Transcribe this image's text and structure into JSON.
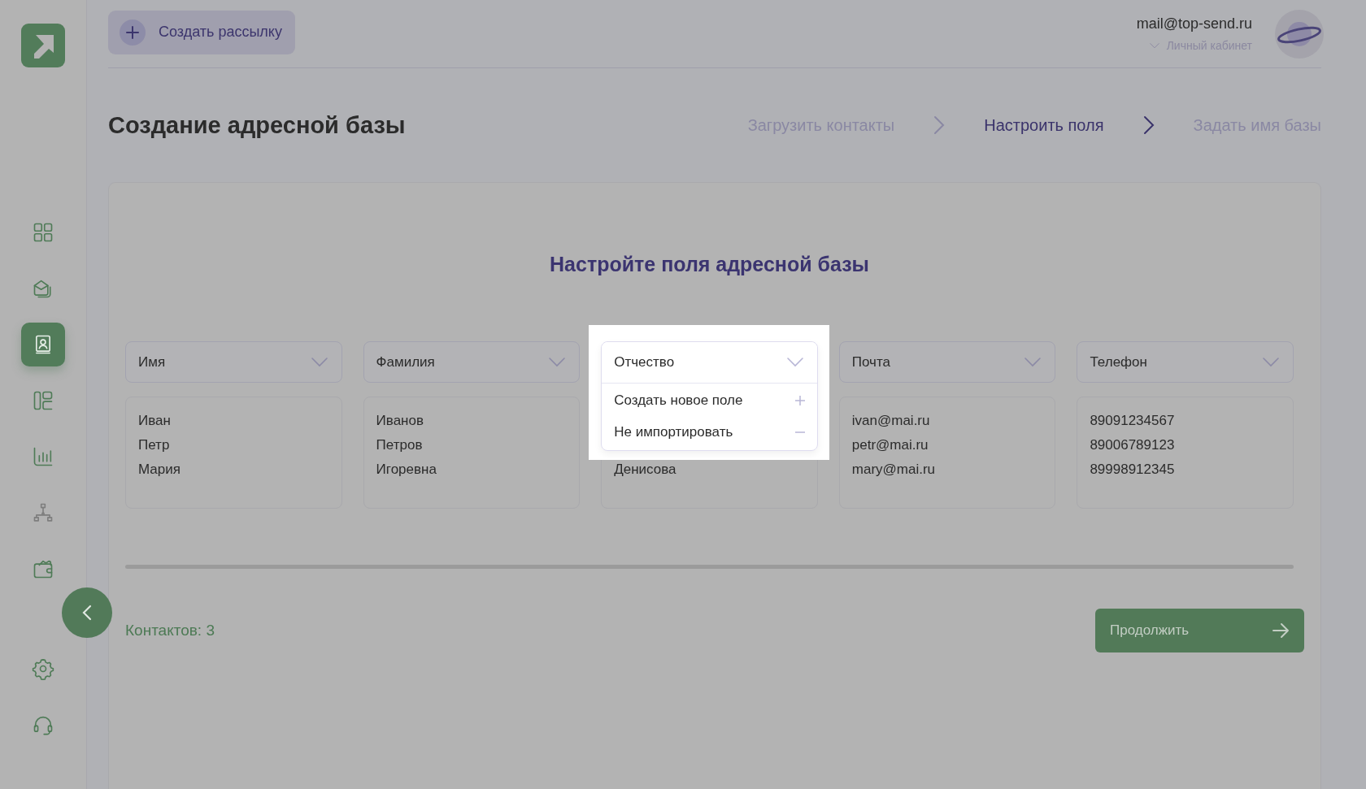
{
  "sidebar": {
    "items": [
      {
        "kind": "dashboard",
        "selected": false,
        "disabled": false
      },
      {
        "kind": "mail",
        "selected": false,
        "disabled": false
      },
      {
        "kind": "contacts",
        "selected": true,
        "disabled": false
      },
      {
        "kind": "templates",
        "selected": false,
        "disabled": false
      },
      {
        "kind": "stats",
        "selected": false,
        "disabled": false
      },
      {
        "kind": "structure",
        "selected": false,
        "disabled": true
      },
      {
        "kind": "wallet",
        "selected": false,
        "disabled": false
      },
      {
        "kind": "settings",
        "selected": false,
        "disabled": false
      },
      {
        "kind": "support",
        "selected": false,
        "disabled": false
      }
    ]
  },
  "header": {
    "create_button": "Создать рассылку",
    "email": "mail@top-send.ru",
    "account_link": "Личный кабинет"
  },
  "page_title": "Создание адресной базы",
  "steps": [
    {
      "label": "Загрузить контакты",
      "selected": false
    },
    {
      "label": "Настроить поля",
      "selected": true
    },
    {
      "label": "Задать имя базы",
      "selected": false
    }
  ],
  "card": {
    "heading": "Настройте поля адресной базы",
    "columns": [
      {
        "field": "Имя",
        "expanded": false,
        "values": [
          "Иван",
          "Петр",
          "Мария"
        ]
      },
      {
        "field": "Фамилия",
        "expanded": false,
        "values": [
          "Иванов",
          "Петров",
          "Игоревна"
        ]
      },
      {
        "field": "Отчество",
        "expanded": true,
        "values": [
          "Денисова"
        ],
        "options": [
          {
            "label": "Создать новое поле",
            "kind": "add"
          },
          {
            "label": "Не импортировать",
            "kind": "remove"
          }
        ]
      },
      {
        "field": "Почта",
        "expanded": false,
        "values": [
          "ivan@mai.ru",
          "petr@mai.ru",
          "mary@mai.ru"
        ]
      },
      {
        "field": "Телефон",
        "expanded": false,
        "values": [
          "89091234567",
          "89006789123",
          "89998912345"
        ]
      }
    ]
  },
  "footer": {
    "count": "Контактов: 3",
    "continue_button": "Продолжить"
  }
}
